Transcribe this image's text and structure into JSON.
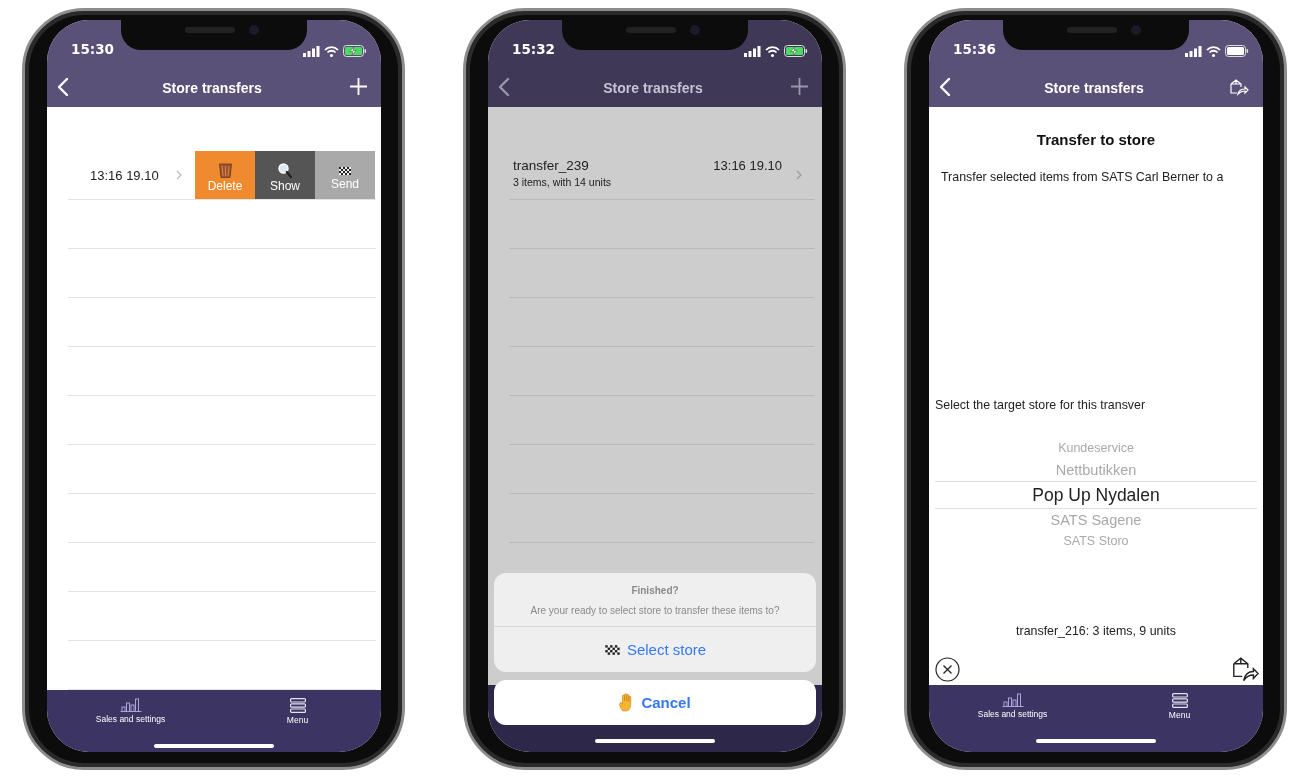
{
  "phones": [
    {
      "kind": "swipe_list",
      "status_bar": {
        "time": "15:30",
        "charging": true
      },
      "nav_bar": {
        "title": "Store transfers",
        "right_button": {
          "kind": "add"
        },
        "dimmed": false
      },
      "rows": [
        {
          "time": "13:16 19.10",
          "actions": [
            {
              "kind": "delete",
              "label": "Delete"
            },
            {
              "kind": "show",
              "label": "Show"
            },
            {
              "kind": "send",
              "label": "Send"
            }
          ]
        }
      ],
      "tab_bar": {
        "items": [
          {
            "kind": "chart",
            "label": "Sales and settings"
          },
          {
            "kind": "menu",
            "label": "Menu"
          }
        ]
      }
    },
    {
      "kind": "action_sheet",
      "status_bar": {
        "time": "15:32",
        "charging": true
      },
      "nav_bar": {
        "title": "Store transfers",
        "right_button": {
          "kind": "add"
        },
        "dimmed": true
      },
      "rows": [
        {
          "name": "transfer_239",
          "detail": "3 items, with 14 units",
          "time": "13:16 19.10"
        }
      ],
      "action_sheet": {
        "title": "Finished?",
        "message": "Are your ready to select store to transfer these items to?",
        "actions": [
          {
            "kind": "flag",
            "label": "Select store"
          }
        ],
        "cancel": {
          "kind": "hand",
          "label": "Cancel"
        }
      }
    },
    {
      "kind": "transfer_form",
      "status_bar": {
        "time": "15:36",
        "charging": false
      },
      "nav_bar": {
        "title": "Store transfers",
        "right_button": {
          "kind": "share"
        },
        "dimmed": false
      },
      "heading": "Transfer to store",
      "intro": "Transfer selected items from SATS Carl Berner to a",
      "prompt": "Select the target store for this transver",
      "picker": [
        {
          "label": "Kundeservice",
          "selected": false
        },
        {
          "label": "Nettbutikken",
          "selected": false
        },
        {
          "label": "Pop Up Nydalen",
          "selected": true
        },
        {
          "label": "SATS Sagene",
          "selected": false
        },
        {
          "label": "SATS Storo",
          "selected": false
        }
      ],
      "summary": "transfer_216: 3 items, 9 units",
      "tab_bar": {
        "items": [
          {
            "kind": "chart",
            "label": "Sales and settings"
          },
          {
            "kind": "menu",
            "label": "Menu"
          }
        ]
      }
    }
  ]
}
